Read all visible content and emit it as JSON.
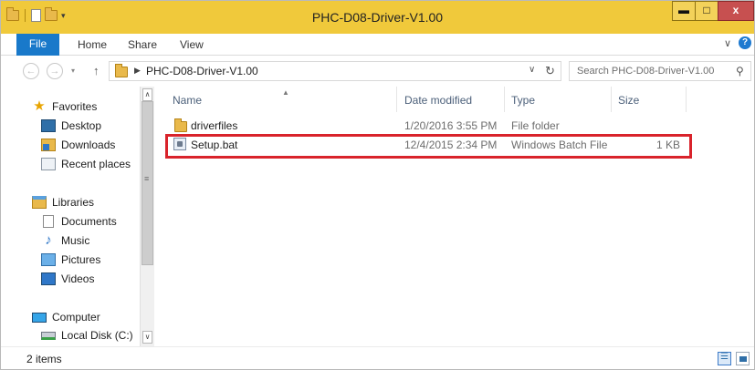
{
  "window": {
    "title": "PHC-D08-Driver-V1.00",
    "controls": {
      "minimize": "▬",
      "maximize": "□",
      "close": "x"
    }
  },
  "ribbon": {
    "tabs": [
      "File",
      "Home",
      "Share",
      "View"
    ],
    "help_icon": "?"
  },
  "address_bar": {
    "path": "PHC-D08-Driver-V1.00",
    "search_placeholder": "Search PHC-D08-Driver-V1.00"
  },
  "nav_pane": {
    "favorites": {
      "label": "Favorites",
      "icon": "star-icon"
    },
    "favorite_items": [
      {
        "label": "Desktop",
        "icon": "desktop-icon"
      },
      {
        "label": "Downloads",
        "icon": "downloads-icon"
      },
      {
        "label": "Recent places",
        "icon": "recent-places-icon"
      }
    ],
    "libraries": {
      "label": "Libraries",
      "icon": "libraries-icon"
    },
    "library_items": [
      {
        "label": "Documents",
        "icon": "documents-icon"
      },
      {
        "label": "Music",
        "icon": "music-icon"
      },
      {
        "label": "Pictures",
        "icon": "pictures-icon"
      },
      {
        "label": "Videos",
        "icon": "videos-icon"
      }
    ],
    "computer": {
      "label": "Computer",
      "icon": "computer-icon"
    },
    "computer_items": [
      {
        "label": "Local Disk (C:)",
        "icon": "local-disk-icon"
      }
    ]
  },
  "file_list": {
    "columns": [
      "Name",
      "Date modified",
      "Type",
      "Size"
    ],
    "rows": [
      {
        "name": "driverfiles",
        "date": "1/20/2016 3:55 PM",
        "type": "File folder",
        "size": "",
        "icon": "folder-icon"
      },
      {
        "name": "Setup.bat",
        "date": "12/4/2015 2:34 PM",
        "type": "Windows Batch File",
        "size": "1 KB",
        "icon": "batch-file-icon"
      }
    ],
    "highlight_color": "#d9232b"
  },
  "status_bar": {
    "item_count": "2 items"
  },
  "colors": {
    "title_bar": "#f0c93b",
    "file_tab": "#1979ca",
    "close_button": "#c75050"
  }
}
